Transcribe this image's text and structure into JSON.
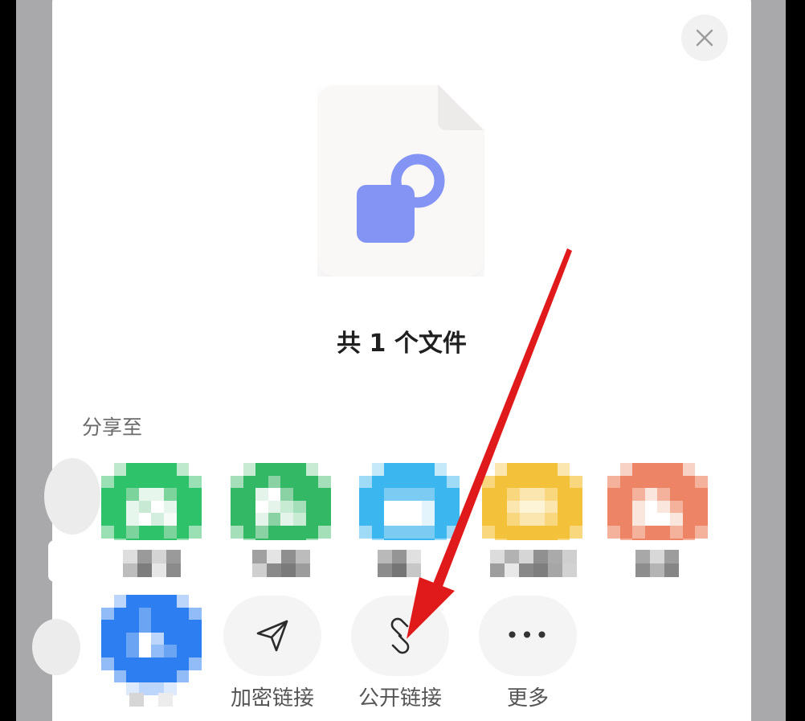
{
  "file_count_text": "共 1 个文件",
  "share_to_label": "分享至",
  "actions": {
    "encrypted_link": "加密链接",
    "public_link": "公开链接",
    "more": "更多"
  },
  "icons": {
    "close": "close-icon",
    "file": "file-share-icon",
    "send": "send-icon",
    "link": "link-icon",
    "more": "more-icon"
  },
  "colors": {
    "accent": "#8494f4",
    "arrow": "#e0191b",
    "wechat_green": "#2ec26a",
    "qq_blue": "#3bb6ef",
    "yellow": "#f4c23a",
    "orange": "#ee8466",
    "blue": "#2d7ef0"
  }
}
